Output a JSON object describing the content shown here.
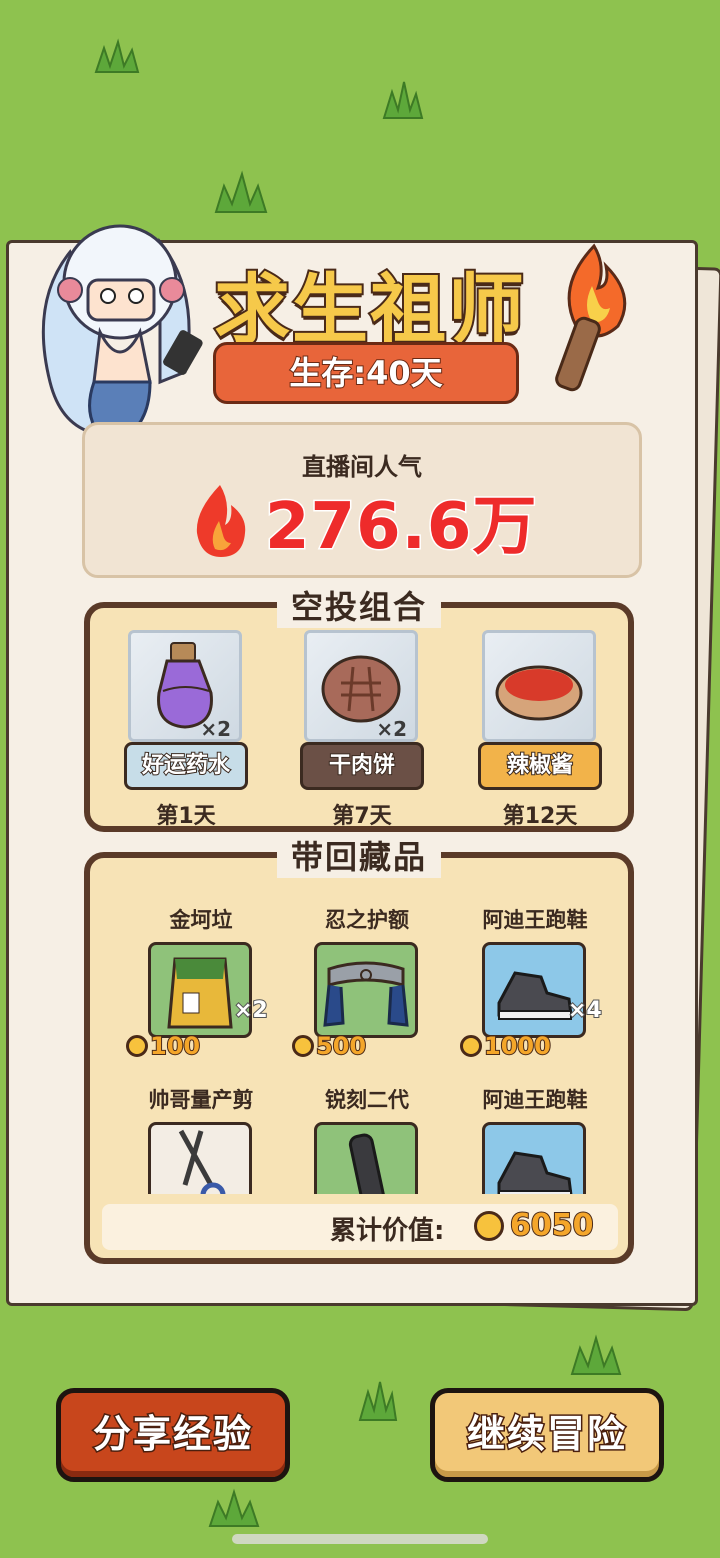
{
  "title": "求生祖师",
  "survival": {
    "label": "生存:40天"
  },
  "popularity": {
    "label": "直播间人气",
    "value": "276.6万"
  },
  "airdrop": {
    "title": "空投组合",
    "items": [
      {
        "name": "好运药水",
        "qty": "×2",
        "day": "第1天",
        "icon": "potion-icon",
        "tag_color": "#c7dde8"
      },
      {
        "name": "干肉饼",
        "qty": "×2",
        "day": "第7天",
        "icon": "meat-patty-icon",
        "tag_color": "#6b5046"
      },
      {
        "name": "辣椒酱",
        "qty": "",
        "day": "第12天",
        "icon": "chili-sauce-icon",
        "tag_color": "#f2b34a"
      }
    ]
  },
  "loot": {
    "title": "带回藏品",
    "items": [
      {
        "name": "金坷垃",
        "qty": "×2",
        "price": "100",
        "icon": "fertilizer-bag-icon",
        "bg": "#8fc27a"
      },
      {
        "name": "忍之护额",
        "qty": "",
        "price": "500",
        "icon": "ninja-headband-icon",
        "bg": "#8fc27a"
      },
      {
        "name": "阿迪王跑鞋",
        "qty": "×4",
        "price": "1000",
        "icon": "sneaker-icon",
        "bg": "#8dc8e8"
      },
      {
        "name": "帅哥量产剪",
        "qty": "",
        "price": "",
        "icon": "scissors-icon",
        "bg": "#f3ede4"
      },
      {
        "name": "锐刻二代",
        "qty": "",
        "price": "",
        "icon": "vape-icon",
        "bg": "#8fc27a"
      },
      {
        "name": "阿迪王跑鞋",
        "qty": "",
        "price": "",
        "icon": "sneaker-icon",
        "bg": "#8dc8e8"
      }
    ],
    "total_label": "累计价值:",
    "total_value": "6050"
  },
  "buttons": {
    "share": "分享经验",
    "continue": "继续冒险"
  },
  "colors": {
    "accent_red": "#ee2b2b",
    "coin": "#f7c23d",
    "share_btn": "#c8461c",
    "continue_btn": "#f2c878"
  }
}
